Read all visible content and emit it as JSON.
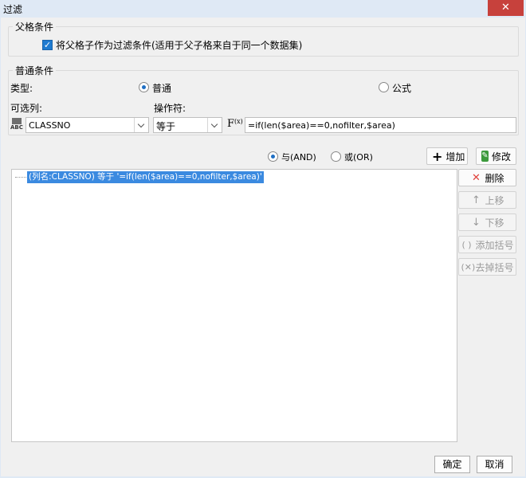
{
  "window": {
    "title": "过滤",
    "close_glyph": "✕"
  },
  "parent_condition": {
    "group_title": "父格条件",
    "checkbox_checked": true,
    "checkbox_label": "将父格子作为过滤条件(适用于父子格来自于同一个数据集)"
  },
  "normal_condition": {
    "group_title": "普通条件",
    "type_label": "类型:",
    "type_options": [
      {
        "label": "普通",
        "selected": true
      },
      {
        "label": "公式",
        "selected": false
      }
    ],
    "column_label": "可选列:",
    "operator_label": "操作符:",
    "column_value": "CLASSNO",
    "column_icon": "abc-column-icon",
    "operator_value": "等于",
    "formula_icon": "fx-icon",
    "formula_value": "=if(len($area)==0,nofilter,$area)"
  },
  "logic": {
    "and_label": "与(AND)",
    "and_selected": true,
    "or_label": "或(OR)",
    "or_selected": false,
    "add_label": "增加",
    "modify_label": "修改"
  },
  "conditions": {
    "items": [
      "(列名:CLASSNO) 等于 '=if(len($area)==0,nofilter,$area)'"
    ],
    "selected_index": 0
  },
  "side_buttons": {
    "delete_label": "删除",
    "up_label": "上移",
    "down_label": "下移",
    "add_bracket_label": "添加括号",
    "remove_bracket_label": "去掉括号"
  },
  "footer": {
    "ok_label": "确定",
    "cancel_label": "取消"
  },
  "colors": {
    "selection": "#3b8ae0",
    "close": "#c7413c",
    "delete": "#e0413b",
    "accent": "#1f7bd1"
  }
}
